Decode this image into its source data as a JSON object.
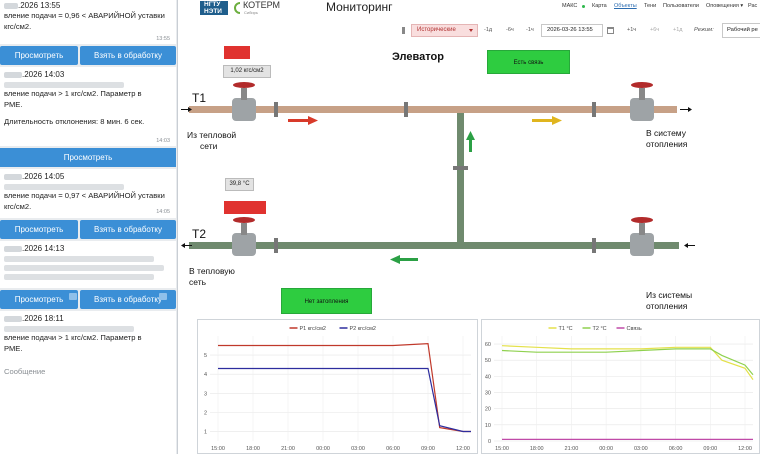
{
  "header": {
    "logo_top": "НГТУ",
    "logo_bottom": "НЭТИ",
    "logo2": "КОТЕРМ",
    "logo2_sub": "Сибирь",
    "title": "Мониторинг",
    "nav": [
      "МАКС",
      "Карта",
      "Объекты",
      "Тени",
      "Пользователи",
      "Оповещения ▾",
      "Рас"
    ]
  },
  "toolbar": {
    "mode_select": "Исторические",
    "step_back": [
      "-1д",
      "-6ч",
      "-1ч"
    ],
    "datetime": "2026-03-26 13:55",
    "step_fwd": [
      "+1ч",
      "+6ч",
      "+1д"
    ],
    "mode_label": "Режим:",
    "mode_value": "Рабочий ре"
  },
  "chat": {
    "cards": [
      {
        "date": ".2026 13:55",
        "text": [
          "вление подачи = 0,96  < АВАРИЙНОЙ уставки",
          "кгс/см2."
        ],
        "time": "13:55"
      },
      {
        "date": ".2026 14:03",
        "text": [
          "вление подачи > 1 кгс/см2. Параметр в",
          "РМЕ.",
          "",
          " Длительность отклонения: 8 мин. 6 сек."
        ],
        "time": "14:03"
      },
      {
        "date": ".2026 14:05",
        "text": [
          "вление подачи = 0,97  < АВАРИЙНОЙ уставки",
          "кгс/см2."
        ],
        "time": "14:05"
      },
      {
        "date": ".2026 14:13",
        "text": [],
        "time": ""
      },
      {
        "date": ".2026 18:11",
        "text": [
          "вление подачи > 1 кгс/см2. Параметр в",
          "РМЕ."
        ],
        "time": ""
      }
    ],
    "btn_view": "Просмотреть",
    "btn_take": "Взять в обработку",
    "btn_view_full": "Просмотреть",
    "input_placeholder": "Сообщение"
  },
  "diagram": {
    "title": "Элеватор",
    "status_connection": "Есть связь",
    "status_heating": "Нет затопления",
    "t1": "Т1",
    "t2": "Т2",
    "from_network": [
      "Из тепловой",
      "сети"
    ],
    "to_system": [
      "В систему",
      "отопления"
    ],
    "to_network": [
      "В тепловую",
      "сеть"
    ],
    "from_system": [
      "Из системы",
      "отопления"
    ],
    "pressure_value": "1,02 кгс/см2",
    "temp_value": "39,8 °C",
    "colors": {
      "ok": "#2ecc40",
      "alarm": "#e0322f",
      "pipe_hot": "#c7a187",
      "pipe_cold": "#6f8a6e"
    }
  },
  "chart_left": {
    "legend": [
      "P1 кгс/см2",
      "P2 кгс/см2"
    ],
    "colors": [
      "#c0392b",
      "#2d2d9e"
    ],
    "y_ticks": [
      "1",
      "2",
      "3",
      "4",
      "5"
    ],
    "x_ticks": [
      "15:00",
      "18:00",
      "21:00",
      "00:00",
      "03:00",
      "06:00",
      "09:00",
      "12:00"
    ]
  },
  "chart_right": {
    "legend": [
      "T1 °C",
      "T2 °C",
      "Связь"
    ],
    "colors": [
      "#e4e14a",
      "#8fd14f",
      "#c04aa8"
    ],
    "y_ticks": [
      "0",
      "10",
      "20",
      "30",
      "40",
      "50",
      "60"
    ],
    "x_ticks": [
      "15:00",
      "18:00",
      "21:00",
      "00:00",
      "03:00",
      "06:00",
      "09:00",
      "12:00"
    ]
  },
  "chart_data": [
    {
      "type": "line",
      "x": [
        "15:00",
        "18:00",
        "21:00",
        "00:00",
        "03:00",
        "06:00",
        "09:00",
        "10:00",
        "12:00",
        "13:00"
      ],
      "series": [
        {
          "name": "P1 кгс/см2",
          "values": [
            5.5,
            5.5,
            5.5,
            5.5,
            5.5,
            5.5,
            5.6,
            1.2,
            1.0,
            1.0
          ]
        },
        {
          "name": "P2 кгс/см2",
          "values": [
            4.3,
            4.3,
            4.3,
            4.3,
            4.3,
            4.3,
            4.3,
            1.3,
            1.0,
            1.0
          ]
        }
      ],
      "ylim": [
        0.5,
        6
      ]
    },
    {
      "type": "line",
      "x": [
        "15:00",
        "18:00",
        "21:00",
        "00:00",
        "03:00",
        "06:00",
        "09:00",
        "10:00",
        "12:00",
        "13:00"
      ],
      "series": [
        {
          "name": "T1 °C",
          "values": [
            59,
            58,
            57,
            57,
            57,
            58,
            58,
            50,
            45,
            38
          ]
        },
        {
          "name": "T2 °C",
          "values": [
            56,
            55,
            55,
            55,
            56,
            57,
            57,
            53,
            47,
            41
          ]
        },
        {
          "name": "Связь",
          "values": [
            1,
            1,
            1,
            1,
            1,
            1,
            1,
            1,
            1,
            1
          ]
        }
      ],
      "ylim": [
        0,
        65
      ]
    }
  ]
}
